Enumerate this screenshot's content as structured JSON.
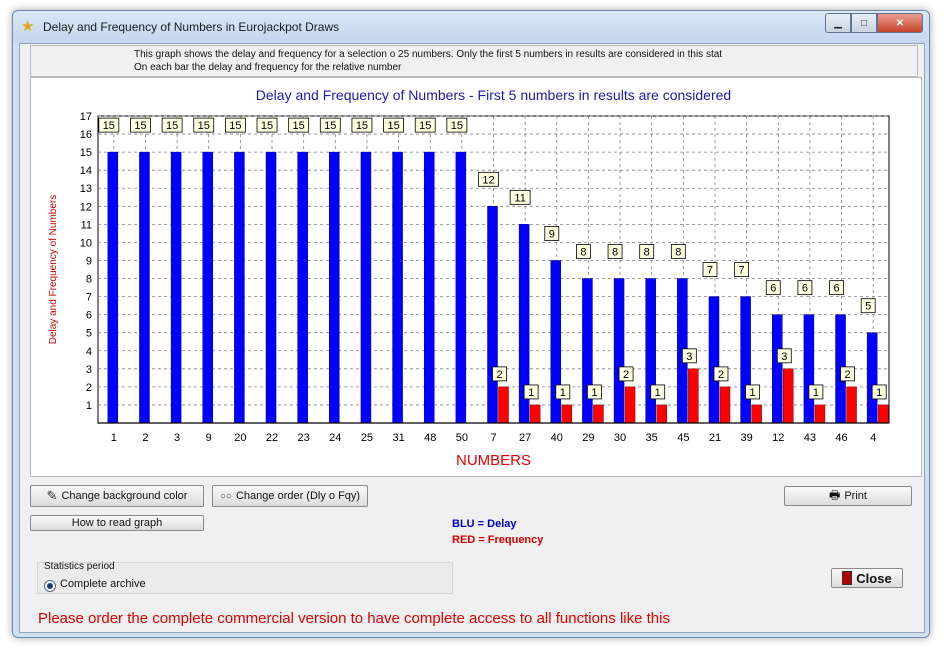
{
  "window": {
    "title": "Delay and Frequency of Numbers in Eurojackpot Draws",
    "icon": "star-icon",
    "controls": {
      "minimize": "minimize-icon",
      "maximize": "maximize-icon",
      "close": "close-icon"
    }
  },
  "description": {
    "line1": "This graph shows the delay and frequency for a selection o 25 numbers. Only the first  5 numbers in results are considered in this stat",
    "line2": "On each bar the delay and frequency for the relative  number"
  },
  "chart_data": {
    "type": "bar",
    "title": "Delay and Frequency of Numbers - First 5 numbers in results are considered",
    "xlabel": "NUMBERS",
    "ylabel": "Delay and Frequency of Numbers",
    "ylim": [
      0,
      17
    ],
    "yticks": [
      1,
      2,
      3,
      4,
      5,
      6,
      7,
      8,
      9,
      10,
      11,
      12,
      13,
      14,
      15,
      16,
      17
    ],
    "grid": true,
    "categories": [
      "1",
      "2",
      "3",
      "9",
      "20",
      "22",
      "23",
      "24",
      "25",
      "31",
      "48",
      "50",
      "7",
      "27",
      "40",
      "29",
      "30",
      "35",
      "45",
      "21",
      "39",
      "12",
      "43",
      "46",
      "4"
    ],
    "series": [
      {
        "name": "Delay",
        "color": "#0000ff",
        "values": [
          15,
          15,
          15,
          15,
          15,
          15,
          15,
          15,
          15,
          15,
          15,
          15,
          12,
          11,
          9,
          8,
          8,
          8,
          8,
          7,
          7,
          6,
          6,
          6,
          5
        ]
      },
      {
        "name": "Frequency",
        "color": "#ff0000",
        "values": [
          0,
          0,
          0,
          0,
          0,
          0,
          0,
          0,
          0,
          0,
          0,
          0,
          2,
          1,
          1,
          1,
          2,
          1,
          3,
          2,
          1,
          3,
          1,
          2,
          1
        ]
      }
    ]
  },
  "buttons": {
    "change_bg": "Change background color",
    "change_order": "Change order (Dly o Fqy)",
    "how_to_read": "How to read graph",
    "print": "Print",
    "close": "Close"
  },
  "legend": {
    "blue": "BLU = Delay",
    "red": "RED = Frequency"
  },
  "stats": {
    "title": "Statistics period",
    "option": "Complete archive"
  },
  "promo": "Please order the complete commercial version to have complete access to all functions like this"
}
